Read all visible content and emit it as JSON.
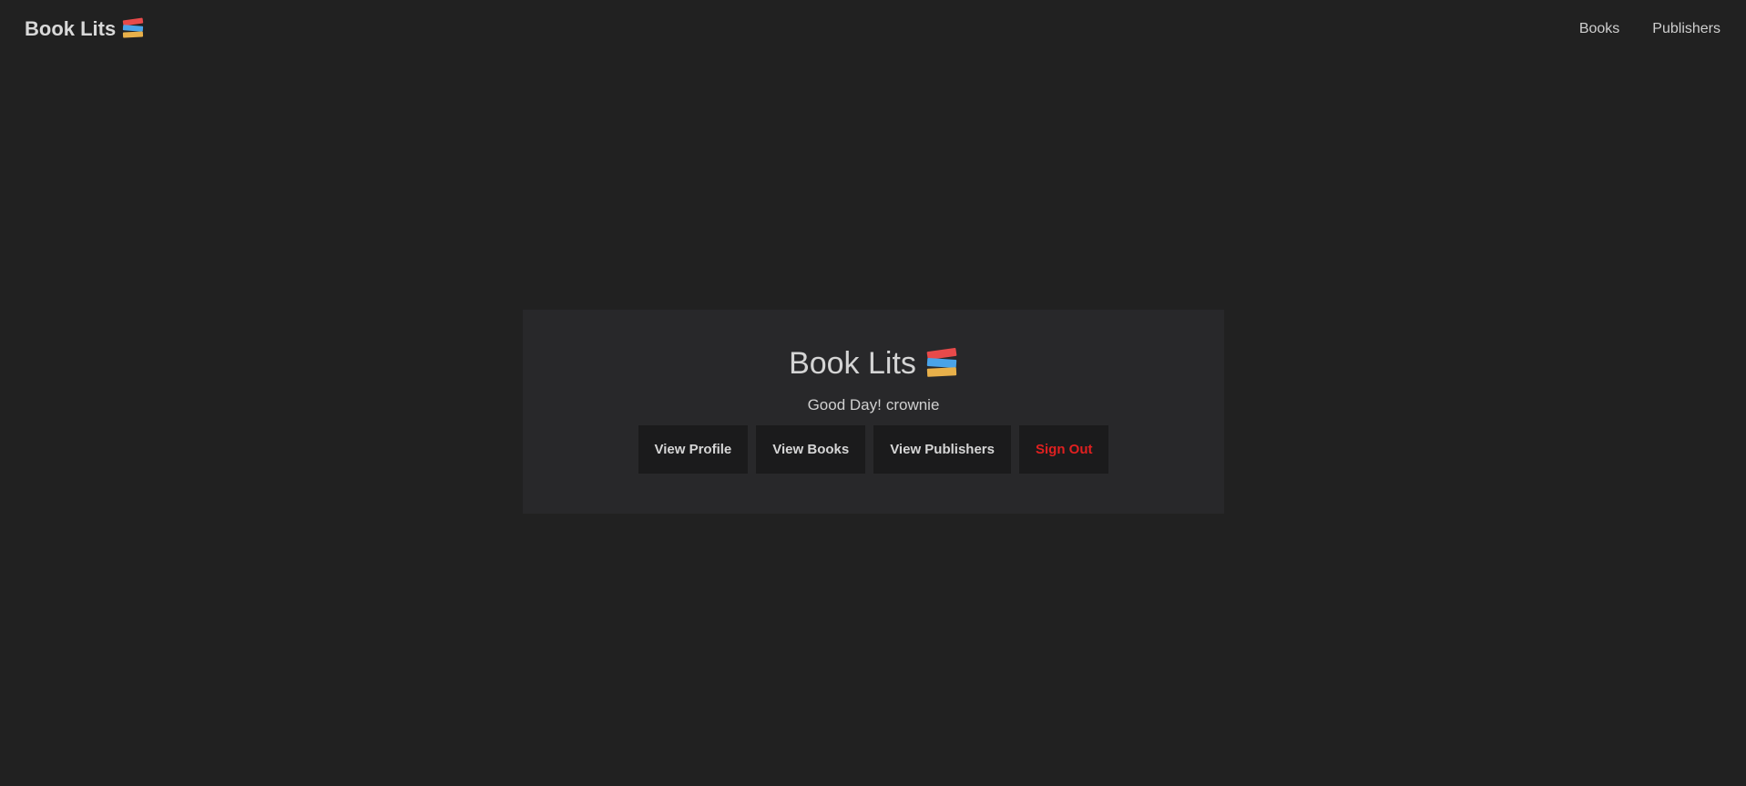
{
  "navbar": {
    "brand": "Book Lits",
    "brand_icon": "books-icon",
    "links": [
      {
        "label": "Books"
      },
      {
        "label": "Publishers"
      }
    ]
  },
  "card": {
    "title": "Book Lits",
    "title_icon": "books-icon",
    "greeting": "Good Day!",
    "username": "crownie",
    "buttons": {
      "view_profile": "View Profile",
      "view_books": "View Books",
      "view_publishers": "View Publishers",
      "sign_out": "Sign Out"
    }
  },
  "colors": {
    "background": "#212121",
    "card": "#28282a",
    "button": "#1b1b1c",
    "danger": "#e02020"
  }
}
